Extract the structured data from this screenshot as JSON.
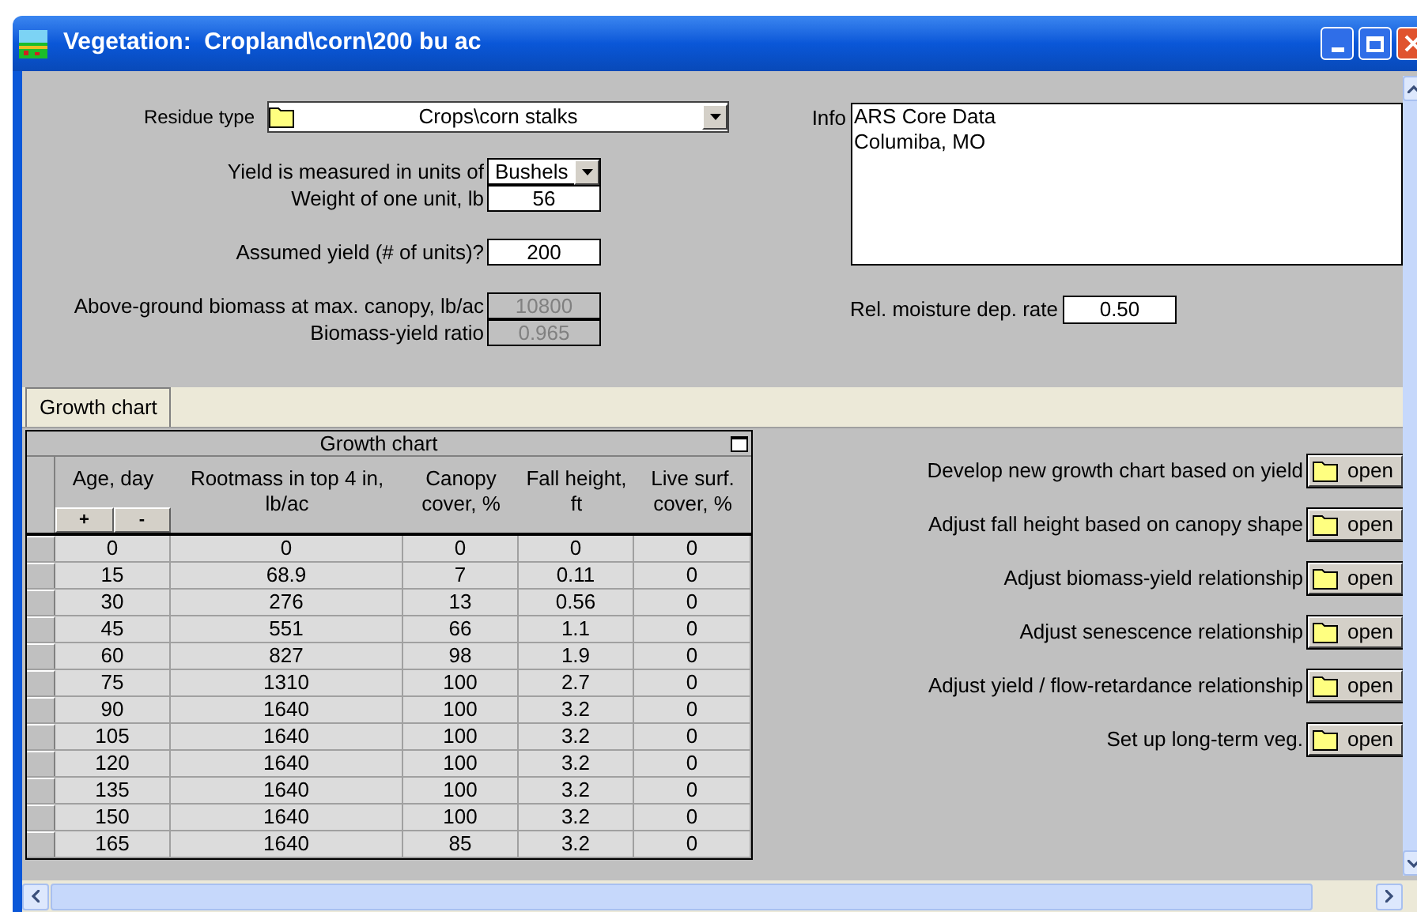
{
  "window": {
    "title": "Vegetation:  Cropland\\corn\\200 bu ac"
  },
  "residue_type": {
    "label": "Residue type",
    "value": "Crops\\corn stalks"
  },
  "field_groups": [
    [
      {
        "label": "Yield is measured in units of",
        "value": "Bushels",
        "kind": "dropdown",
        "disabled": false
      },
      {
        "label": "Weight of one unit, lb",
        "value": "56",
        "kind": "input",
        "disabled": false
      }
    ],
    [
      {
        "label": "Assumed yield (# of units)?",
        "value": "200",
        "kind": "input",
        "disabled": false
      }
    ],
    [
      {
        "label": "Above-ground biomass at max. canopy, lb/ac",
        "value": "10800",
        "kind": "input",
        "disabled": true
      },
      {
        "label": "Biomass-yield ratio",
        "value": "0.965",
        "kind": "input",
        "disabled": true
      }
    ]
  ],
  "info": {
    "label": "Info",
    "lines": [
      "ARS Core Data",
      "Columiba, MO"
    ]
  },
  "moisture": {
    "label": "Rel. moisture dep. rate",
    "value": "0.50"
  },
  "tabs": [
    {
      "label": "Growth chart",
      "selected": true
    }
  ],
  "growth_chart": {
    "title": "Growth chart",
    "add_button": "+",
    "remove_button": "-",
    "columns": [
      "Age, day",
      "Rootmass in top 4 in, lb/ac",
      "Canopy cover, %",
      "Fall height, ft",
      "Live surf. cover, %"
    ],
    "rows": [
      [
        "0",
        "0",
        "0",
        "0",
        "0"
      ],
      [
        "15",
        "68.9",
        "7",
        "0.11",
        "0"
      ],
      [
        "30",
        "276",
        "13",
        "0.56",
        "0"
      ],
      [
        "45",
        "551",
        "66",
        "1.1",
        "0"
      ],
      [
        "60",
        "827",
        "98",
        "1.9",
        "0"
      ],
      [
        "75",
        "1310",
        "100",
        "2.7",
        "0"
      ],
      [
        "90",
        "1640",
        "100",
        "3.2",
        "0"
      ],
      [
        "105",
        "1640",
        "100",
        "3.2",
        "0"
      ],
      [
        "120",
        "1640",
        "100",
        "3.2",
        "0"
      ],
      [
        "135",
        "1640",
        "100",
        "3.2",
        "0"
      ],
      [
        "150",
        "1640",
        "100",
        "3.2",
        "0"
      ],
      [
        "165",
        "1640",
        "85",
        "3.2",
        "0"
      ]
    ]
  },
  "actions": [
    {
      "label": "Develop new growth chart based on yield",
      "button": "open"
    },
    {
      "label": "Adjust fall height based on canopy shape",
      "button": "open"
    },
    {
      "label": "Adjust biomass-yield relationship",
      "button": "open"
    },
    {
      "label": "Adjust senescence relationship",
      "button": "open"
    },
    {
      "label": "Adjust yield / flow-retardance relationship",
      "button": "open"
    },
    {
      "label": "Set up long-term veg.",
      "button": "open"
    }
  ]
}
